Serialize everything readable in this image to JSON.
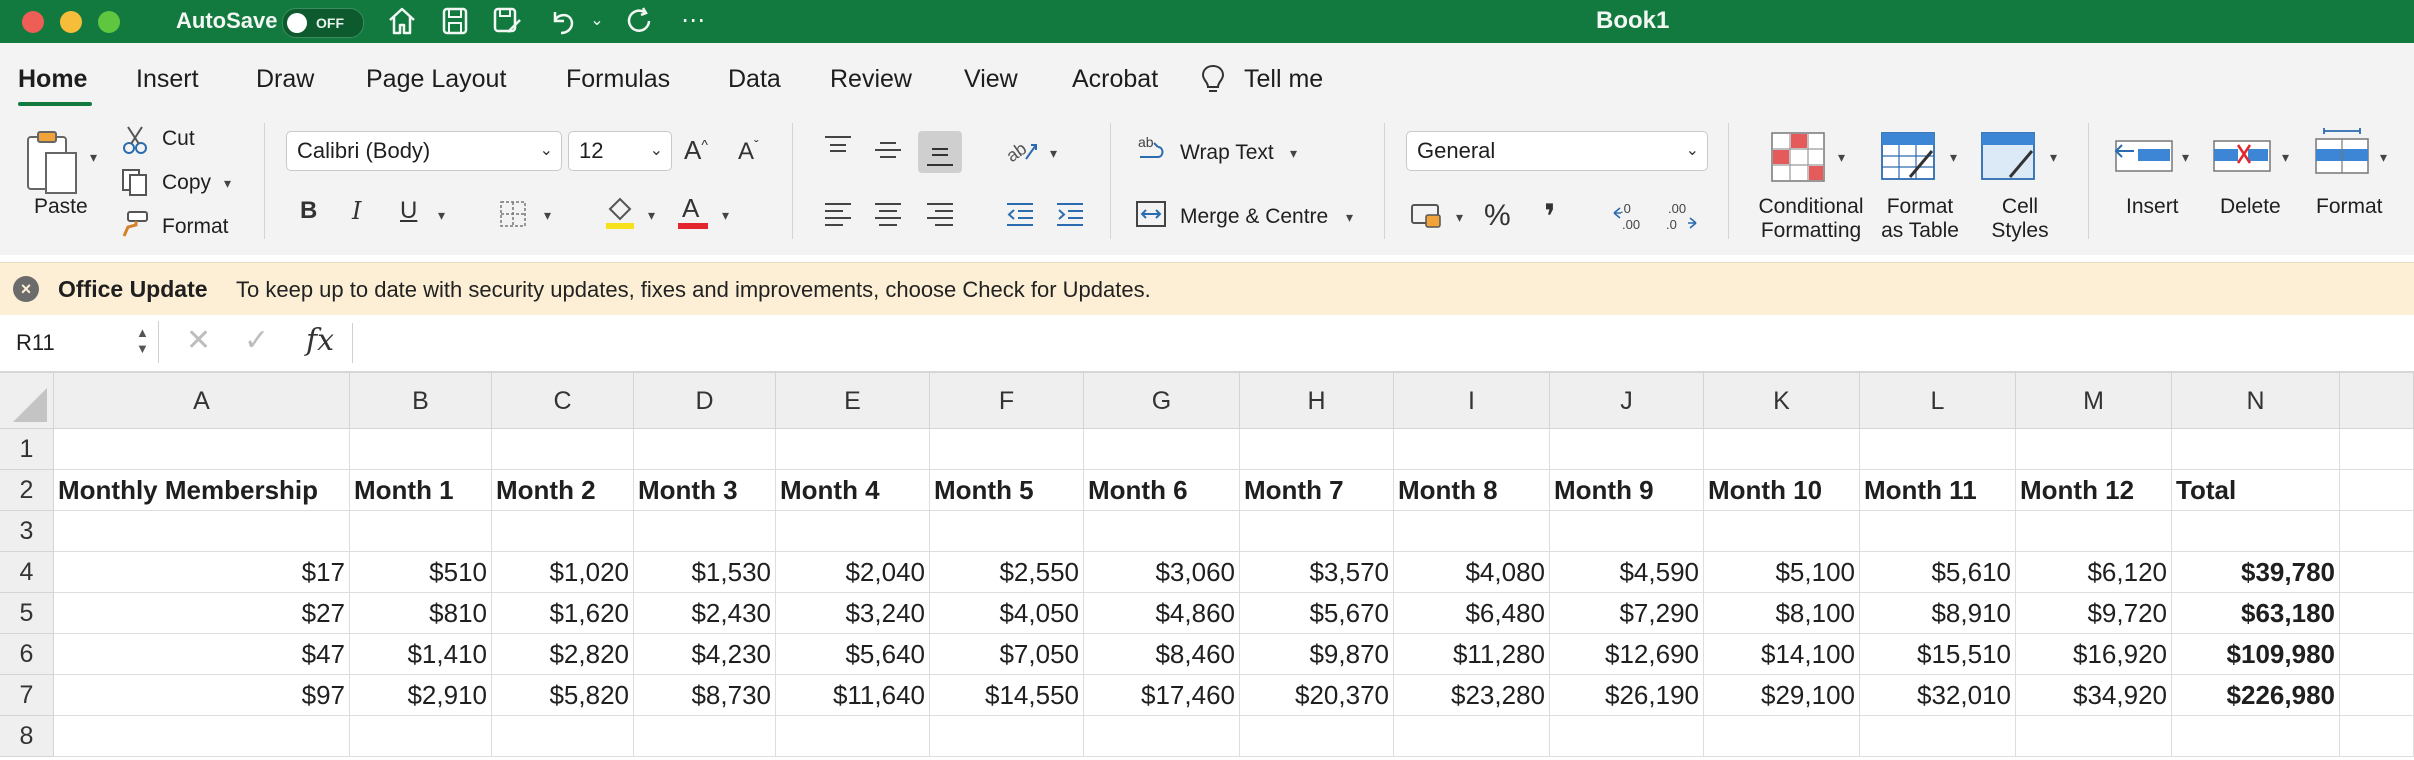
{
  "titlebar": {
    "autosave_label": "AutoSave",
    "autosave_state": "OFF",
    "document_title": "Book1",
    "icons": [
      "home-icon",
      "save-icon",
      "save-as-icon",
      "undo-icon",
      "undo-dropdown-icon",
      "redo-icon",
      "more-icon"
    ]
  },
  "menu": {
    "tabs": [
      "Home",
      "Insert",
      "Draw",
      "Page Layout",
      "Formulas",
      "Data",
      "Review",
      "View",
      "Acrobat"
    ],
    "active": "Home",
    "tell_me": "Tell me"
  },
  "ribbon": {
    "paste": "Paste",
    "cut": "Cut",
    "copy": "Copy",
    "format_painter": "Format",
    "font_name": "Calibri (Body)",
    "font_size": "12",
    "bold": "B",
    "italic": "I",
    "underline": "U",
    "wrap_text": "Wrap Text",
    "merge_centre": "Merge & Centre",
    "number_format": "General",
    "percent": "%",
    "comma": "❜",
    "conditional_formatting_line1": "Conditional",
    "conditional_formatting_line2": "Formatting",
    "format_as_table_line1": "Format",
    "format_as_table_line2": "as Table",
    "cell_styles_line1": "Cell",
    "cell_styles_line2": "Styles",
    "insert": "Insert",
    "delete": "Delete",
    "format": "Format",
    "accent_yellow": "#f7e11c",
    "accent_red": "#e3262d"
  },
  "update_bar": {
    "title": "Office Update",
    "message": "To keep up to date with security updates, fixes and improvements, choose Check for Updates."
  },
  "formula_bar": {
    "name_box": "R11",
    "formula": ""
  },
  "sheet": {
    "columns": [
      "A",
      "B",
      "C",
      "D",
      "E",
      "F",
      "G",
      "H",
      "I",
      "J",
      "K",
      "L",
      "M",
      "N"
    ],
    "rows": [
      "1",
      "2",
      "3",
      "4",
      "5",
      "6",
      "7",
      "8"
    ],
    "header_row": [
      "Monthly Membership",
      "Month 1",
      "Month 2",
      "Month 3",
      "Month 4",
      "Month 5",
      "Month 6",
      "Month 7",
      "Month 8",
      "Month 9",
      "Month 10",
      "Month 11",
      "Month 12",
      "Total"
    ],
    "data_rows": [
      [
        "$17",
        "$510",
        "$1,020",
        "$1,530",
        "$2,040",
        "$2,550",
        "$3,060",
        "$3,570",
        "$4,080",
        "$4,590",
        "$5,100",
        "$5,610",
        "$6,120",
        "$39,780"
      ],
      [
        "$27",
        "$810",
        "$1,620",
        "$2,430",
        "$3,240",
        "$4,050",
        "$4,860",
        "$5,670",
        "$6,480",
        "$7,290",
        "$8,100",
        "$8,910",
        "$9,720",
        "$63,180"
      ],
      [
        "$47",
        "$1,410",
        "$2,820",
        "$4,230",
        "$5,640",
        "$7,050",
        "$8,460",
        "$9,870",
        "$11,280",
        "$12,690",
        "$14,100",
        "$15,510",
        "$16,920",
        "$109,980"
      ],
      [
        "$97",
        "$2,910",
        "$5,820",
        "$8,730",
        "$11,640",
        "$14,550",
        "$17,460",
        "$20,370",
        "$23,280",
        "$26,190",
        "$29,100",
        "$32,010",
        "$34,920",
        "$226,980"
      ]
    ]
  }
}
